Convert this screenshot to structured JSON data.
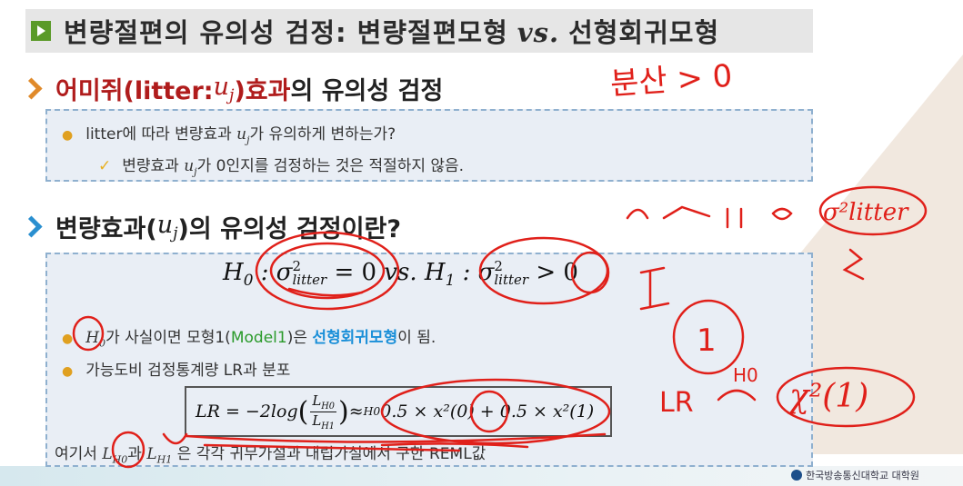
{
  "title": {
    "part1": "변량절편의 유의성 검정: 변량절편모형",
    "vs": "vs.",
    "part2": "선형회귀모형"
  },
  "section1": {
    "heading_red": "어미쥐(litter: ",
    "heading_var": "u",
    "heading_sub": "j",
    "heading_red2": ")효과",
    "heading_rest": "의 유의성 검정",
    "bullet1_a": "litter에 따라 변량효과 ",
    "bullet1_var": "u",
    "bullet1_sub": "j",
    "bullet1_b": "가 유의하게 변하는가?",
    "check1_a": "변량효과 ",
    "check1_var": "u",
    "check1_sub": "j",
    "check1_b": "가 0인지를 검정하는 것은 적절하지 않음."
  },
  "section2": {
    "heading_a": "변량효과(",
    "heading_var": "u",
    "heading_sub": "j",
    "heading_b": ")의 유의성 검정이란?",
    "hypothesis": {
      "h0": "H",
      "h0_sub": "0",
      "colon": " : ",
      "sigma": "σ",
      "sup": "2",
      "sub": "litter",
      "eq0": " = 0",
      "vs": " vs. ",
      "h1": "H",
      "h1_sub": "1",
      "gt0": " > 0"
    },
    "bullet1_var": "H",
    "bullet1_sub": "0",
    "bullet1_a": "가 사실이면 모형1(",
    "bullet1_green": "Model1",
    "bullet1_b": ")은 ",
    "bullet1_blue": "선형회귀모형",
    "bullet1_c": "이 됨.",
    "bullet2": "가능도비 검정통계량 LR과 분포",
    "lr": {
      "lhs": "LR = −2log",
      "num": "L",
      "num_sub": "H0",
      "den": "L",
      "den_sub": "H1",
      "approx": " ≈",
      "approx_sup": "H0",
      "rhs": " 0.5 × x²(0) + 0.5 × x²(1)"
    },
    "note_a": "여기서 ",
    "note_l1": "L",
    "note_l1_sub": "H0",
    "note_b": "과 ",
    "note_l2": "L",
    "note_l2_sub": "H1",
    "note_c": " 은 각각 귀무가설과 대립가설에서 구한 REML값"
  },
  "handwriting": {
    "top": "분산 > 0",
    "mid": "σ²litter",
    "one": "1",
    "lr": "LR",
    "ho": "H0",
    "chi": "χ²(1)"
  },
  "logo": "한국방송통신대학교 대학원",
  "colors": {
    "ink": "#e0201a",
    "accent_green": "#5a9a28",
    "accent_blue": "#1a8fd8",
    "accent_red": "#b01c1c"
  }
}
